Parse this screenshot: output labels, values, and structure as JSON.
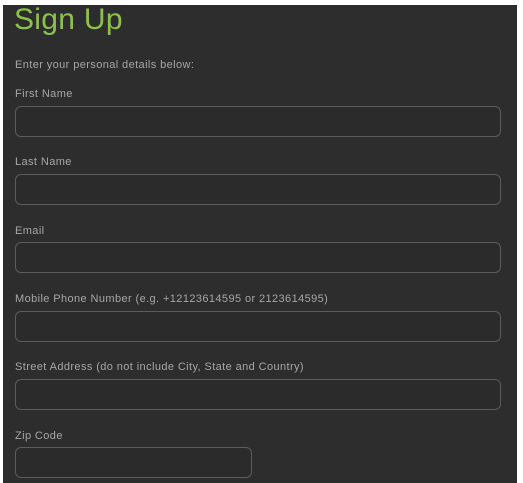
{
  "form": {
    "title": "Sign Up",
    "subtitle": "Enter your personal details below:",
    "fields": [
      {
        "label": "First Name",
        "value": "",
        "placeholder": ""
      },
      {
        "label": "Last Name",
        "value": "",
        "placeholder": ""
      },
      {
        "label": "Email",
        "value": "",
        "placeholder": ""
      },
      {
        "label": "Mobile Phone Number (e.g. +12123614595 or 2123614595)",
        "value": "",
        "placeholder": ""
      },
      {
        "label": "Street Address (do not include City, State and Country)",
        "value": "",
        "placeholder": ""
      },
      {
        "label": "Zip Code",
        "value": "",
        "placeholder": ""
      }
    ]
  },
  "colors": {
    "background": "#2d2d2d",
    "title": "#8bc34a",
    "label_text": "#a6a6a6",
    "field_border": "#5c5c5c"
  }
}
